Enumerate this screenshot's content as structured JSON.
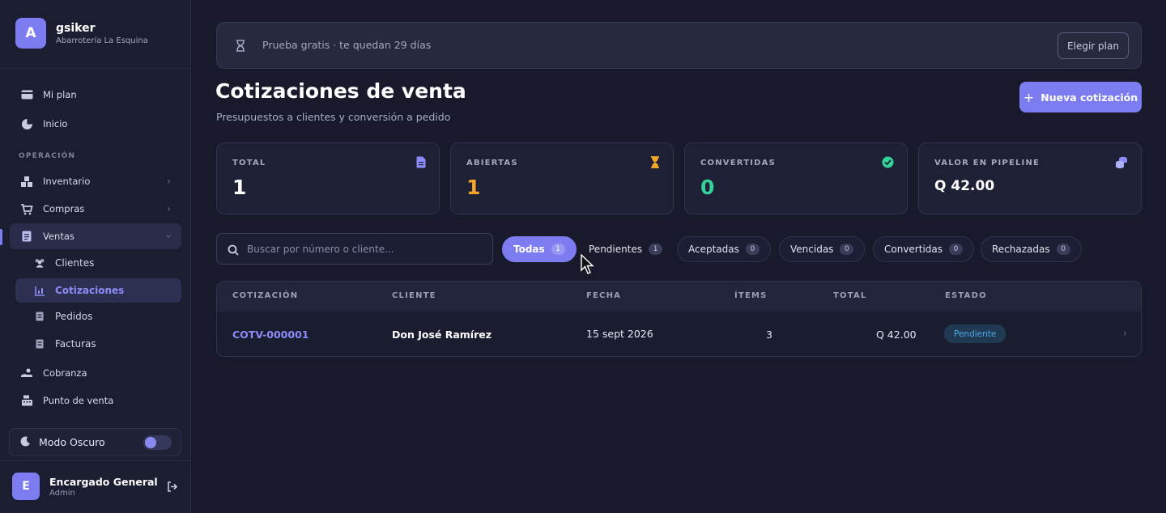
{
  "sidebar": {
    "avatar_letter": "A",
    "username": "gsiker",
    "store": "Abarrotería La Esquina",
    "items": [
      {
        "label": "Mi plan",
        "icon": "card-icon"
      },
      {
        "label": "Inicio",
        "icon": "pie-chart-icon"
      }
    ],
    "section_label": "OPERACIÓN",
    "ops": [
      {
        "label": "Inventario",
        "icon": "boxes-icon"
      },
      {
        "label": "Compras",
        "icon": "cart-icon"
      },
      {
        "label": "Ventas",
        "icon": "document-icon"
      }
    ],
    "ventas_sub": [
      {
        "label": "Clientes",
        "icon": "users-icon"
      },
      {
        "label": "Cotizaciones",
        "icon": "chart-icon"
      },
      {
        "label": "Pedidos",
        "icon": "document-icon"
      },
      {
        "label": "Facturas",
        "icon": "document-icon"
      }
    ],
    "more": [
      {
        "label": "Cobranza",
        "icon": "hand-money-icon"
      },
      {
        "label": "Punto de venta",
        "icon": "cash-register-icon"
      }
    ],
    "dark_mode_label": "Modo Oscuro",
    "user": {
      "initial": "E",
      "name": "Encargado General",
      "role": "Admin"
    }
  },
  "trial": {
    "text": "Prueba gratis · te quedan 29 días",
    "button": "Elegir plan"
  },
  "header": {
    "title": "Cotizaciones de venta",
    "subtitle": "Presupuestos a clientes y conversión a pedido",
    "new_button": "Nueva cotización"
  },
  "stats": [
    {
      "label": "TOTAL",
      "value": "1",
      "color": "#ffffff",
      "icon": "file-icon"
    },
    {
      "label": "ABIERTAS",
      "value": "1",
      "color": "#f4a62a",
      "icon": "hourglass-icon"
    },
    {
      "label": "CONVERTIDAS",
      "value": "0",
      "color": "#34d399",
      "icon": "check-circle-icon"
    },
    {
      "label": "VALOR EN PIPELINE",
      "value": "Q 42.00",
      "color": "#ffffff",
      "icon": "coins-icon"
    }
  ],
  "search": {
    "placeholder": "Buscar por número o cliente..."
  },
  "filters": [
    {
      "label": "Todas",
      "count": "1"
    },
    {
      "label": "Pendientes",
      "count": "1"
    },
    {
      "label": "Aceptadas",
      "count": "0"
    },
    {
      "label": "Vencidas",
      "count": "0"
    },
    {
      "label": "Convertidas",
      "count": "0"
    },
    {
      "label": "Rechazadas",
      "count": "0"
    }
  ],
  "table": {
    "headers": [
      "COTIZACIÓN",
      "CLIENTE",
      "FECHA",
      "ÍTEMS",
      "TOTAL",
      "ESTADO"
    ],
    "rows": [
      {
        "id": "COTV-000001",
        "cliente": "Don José Ramírez",
        "fecha": "15 sept 2026",
        "items": "3",
        "total": "Q 42.00",
        "estado": "Pendiente"
      }
    ]
  },
  "colors": {
    "accent": "#7c7cf0",
    "background": "#181a2c",
    "pending": "#4ba8e6"
  }
}
